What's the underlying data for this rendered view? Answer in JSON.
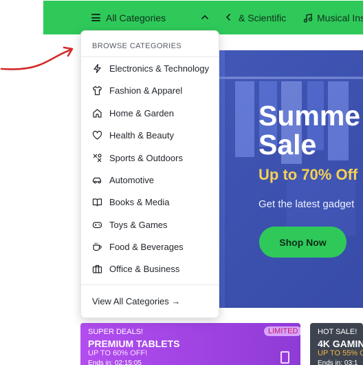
{
  "navbar": {
    "all_categories_label": "All Categories",
    "visible_categories": [
      {
        "label": "& Scientific",
        "icon": "none"
      },
      {
        "label": "Musical Inst",
        "icon": "music-note-icon"
      }
    ]
  },
  "dropdown": {
    "header": "BROWSE CATEGORIES",
    "items": [
      {
        "label": "Electronics & Technology",
        "icon": "lightning-icon"
      },
      {
        "label": "Fashion & Apparel",
        "icon": "shirt-icon"
      },
      {
        "label": "Home & Garden",
        "icon": "house-icon"
      },
      {
        "label": "Health & Beauty",
        "icon": "heart-icon"
      },
      {
        "label": "Sports & Outdoors",
        "icon": "sports-icon"
      },
      {
        "label": "Automotive",
        "icon": "car-icon"
      },
      {
        "label": "Books & Media",
        "icon": "book-icon"
      },
      {
        "label": "Toys & Games",
        "icon": "gamepad-icon"
      },
      {
        "label": "Food & Beverages",
        "icon": "cup-icon"
      },
      {
        "label": "Office & Business",
        "icon": "briefcase-icon"
      }
    ],
    "footer": "View All Categories →"
  },
  "hero": {
    "title_line1": "Summe",
    "title_line2": "Sale",
    "discount": "Up to 70% Off",
    "subtitle": "Get the latest gadget",
    "button": "Shop Now"
  },
  "promos": [
    {
      "tag": "SUPER DEALS!",
      "title": "PREMIUM TABLETS",
      "offer": "UP TO 60% OFF!",
      "ends": "Ends in: 02:15:05",
      "badge": "LIMITED"
    },
    {
      "tag": "HOT SALE!",
      "title": "4K GAMING",
      "offer": "UP TO 55% OF",
      "ends": "Ends in: 03:1"
    }
  ],
  "colors": {
    "nav_green": "#2fc95a",
    "hero_blue": "#4a63c8",
    "discount_yellow": "#f7d154",
    "promo_purple": "#b34df0",
    "annotation_red": "#d42a2a"
  }
}
